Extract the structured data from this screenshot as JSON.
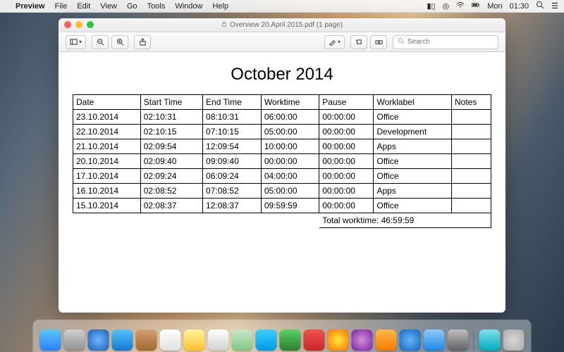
{
  "menubar": {
    "app_name": "Preview",
    "items": [
      "File",
      "Edit",
      "View",
      "Go",
      "Tools",
      "Window",
      "Help"
    ],
    "clock_day": "Mon",
    "clock_time": "01:30"
  },
  "window": {
    "title": "Overview 20.April 2015.pdf (1 page)"
  },
  "toolbar": {
    "search_placeholder": "Search"
  },
  "document": {
    "title": "October 2014",
    "columns": [
      "Date",
      "Start Time",
      "End Time",
      "Worktime",
      "Pause",
      "Worklabel",
      "Notes"
    ],
    "rows": [
      {
        "date": "23.10.2014",
        "start": "02:10:31",
        "end": "08:10:31",
        "worktime": "06:00:00",
        "pause": "00:00:00",
        "label": "Office",
        "notes": ""
      },
      {
        "date": "22.10.2014",
        "start": "02:10:15",
        "end": "07:10:15",
        "worktime": "05:00:00",
        "pause": "00:00:00",
        "label": "Development",
        "notes": ""
      },
      {
        "date": "21.10.2014",
        "start": "02:09:54",
        "end": "12:09:54",
        "worktime": "10:00:00",
        "pause": "00:00:00",
        "label": "Apps",
        "notes": ""
      },
      {
        "date": "20.10.2014",
        "start": "02:09:40",
        "end": "09:09:40",
        "worktime": "00:00:00",
        "pause": "00:00:00",
        "label": "Office",
        "notes": ""
      },
      {
        "date": "17.10.2014",
        "start": "02:09:24",
        "end": "06:09:24",
        "worktime": "04:00:00",
        "pause": "00:00:00",
        "label": "Office",
        "notes": ""
      },
      {
        "date": "16.10.2014",
        "start": "02:08:52",
        "end": "07:08:52",
        "worktime": "05:00:00",
        "pause": "00:00:00",
        "label": "Apps",
        "notes": ""
      },
      {
        "date": "15.10.2014",
        "start": "02:08:37",
        "end": "12:08:37",
        "worktime": "09:59:59",
        "pause": "00:00:00",
        "label": "Office",
        "notes": ""
      }
    ],
    "summary_label": "Total worktime:",
    "summary_value": "46:59:59"
  },
  "dock": {
    "apps": [
      {
        "name": "finder",
        "color": "linear-gradient(#5ac8fa,#2a7fff)"
      },
      {
        "name": "launchpad",
        "color": "linear-gradient(#d0d0d0,#909090)"
      },
      {
        "name": "safari",
        "color": "radial-gradient(#6fb6ff,#1a5fb4)"
      },
      {
        "name": "mail",
        "color": "linear-gradient(#4fc3f7,#1976d2)"
      },
      {
        "name": "contacts",
        "color": "linear-gradient(#d2a070,#a06830)"
      },
      {
        "name": "calendar",
        "color": "linear-gradient(#ffffff,#e0e0e0)"
      },
      {
        "name": "notes",
        "color": "linear-gradient(#fff59d,#fbc02d)"
      },
      {
        "name": "reminders",
        "color": "linear-gradient(#ffffff,#d0d0d0)"
      },
      {
        "name": "maps",
        "color": "linear-gradient(#c8e6c9,#81c784)"
      },
      {
        "name": "messages",
        "color": "linear-gradient(#39d1ff,#0099e5)"
      },
      {
        "name": "facetime",
        "color": "linear-gradient(#58d364,#2e7d32)"
      },
      {
        "name": "photobooth",
        "color": "linear-gradient(#ef5350,#c62828)"
      },
      {
        "name": "photos",
        "color": "radial-gradient(#ffeb3b,#ff6f00)"
      },
      {
        "name": "itunes",
        "color": "radial-gradient(#ce93d8,#7b1fa2)"
      },
      {
        "name": "ibooks",
        "color": "linear-gradient(#ffb74d,#f57c00)"
      },
      {
        "name": "appstore",
        "color": "radial-gradient(#64b5f6,#1565c0)"
      },
      {
        "name": "preview",
        "color": "linear-gradient(#90caf9,#1e88e5)"
      },
      {
        "name": "system-preferences",
        "color": "linear-gradient(#bdbdbd,#616161)"
      }
    ],
    "right": [
      {
        "name": "downloads",
        "color": "linear-gradient(#80deea,#00acc1)"
      }
    ]
  },
  "chart_data": {
    "type": "table",
    "title": "October 2014",
    "columns": [
      "Date",
      "Start Time",
      "End Time",
      "Worktime",
      "Pause",
      "Worklabel",
      "Notes"
    ],
    "rows": [
      [
        "23.10.2014",
        "02:10:31",
        "08:10:31",
        "06:00:00",
        "00:00:00",
        "Office",
        ""
      ],
      [
        "22.10.2014",
        "02:10:15",
        "07:10:15",
        "05:00:00",
        "00:00:00",
        "Development",
        ""
      ],
      [
        "21.10.2014",
        "02:09:54",
        "12:09:54",
        "10:00:00",
        "00:00:00",
        "Apps",
        ""
      ],
      [
        "20.10.2014",
        "02:09:40",
        "09:09:40",
        "00:00:00",
        "00:00:00",
        "Office",
        ""
      ],
      [
        "17.10.2014",
        "02:09:24",
        "06:09:24",
        "04:00:00",
        "00:00:00",
        "Office",
        ""
      ],
      [
        "16.10.2014",
        "02:08:52",
        "07:08:52",
        "05:00:00",
        "00:00:00",
        "Apps",
        ""
      ],
      [
        "15.10.2014",
        "02:08:37",
        "12:08:37",
        "09:59:59",
        "00:00:00",
        "Office",
        ""
      ]
    ],
    "summary": {
      "label": "Total worktime:",
      "value": "46:59:59"
    }
  }
}
